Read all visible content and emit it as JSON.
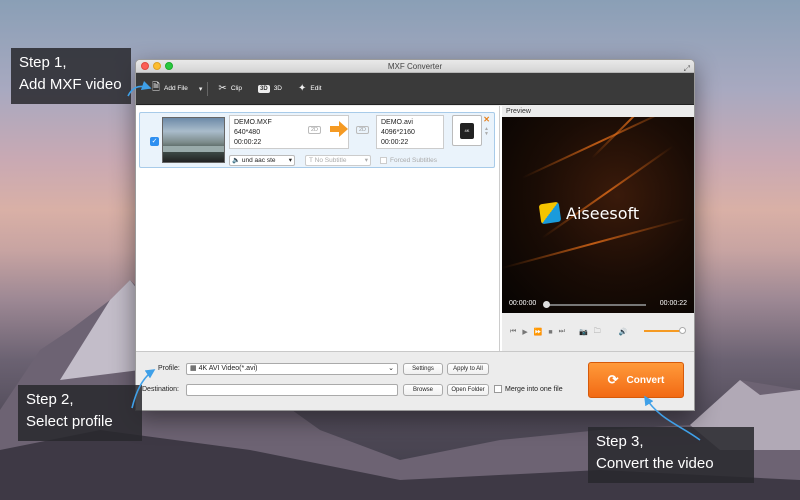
{
  "window": {
    "title": "MXF Converter"
  },
  "toolbar": {
    "add_file": "Add File",
    "clip": "Clip",
    "three_d_badge": "3D",
    "three_d": "3D",
    "edit": "Edit"
  },
  "file_item": {
    "source_name": "DEMO.MXF",
    "source_resolution": "640*480",
    "source_duration": "00:00:22",
    "dest_name": "DEMO.avi",
    "dest_resolution": "4096*2160",
    "dest_duration": "00:00:22",
    "tag_2d": "2D",
    "audio_track": "und aac ste",
    "subtitle": "No Subtitle",
    "forced_subtitles": "Forced Subtitles"
  },
  "preview": {
    "label": "Preview",
    "logo_text": "Aiseesoft",
    "time_current": "00:00:00",
    "time_total": "00:00:22"
  },
  "bottom": {
    "profile_label": "Profile:",
    "profile_value": "4K AVI Video(*.avi)",
    "settings": "Settings",
    "apply_to_all": "Apply to All",
    "destination_label": "Destination:",
    "browse": "Browse",
    "open_folder": "Open Folder",
    "merge": "Merge into one file",
    "convert": "Convert"
  },
  "callouts": {
    "step1_line1": "Step 1,",
    "step1_line2": "Add MXF video",
    "step2_line1": "Step 2,",
    "step2_line2": "Select profile",
    "step3_line1": "Step 3,",
    "step3_line2": "Convert the video"
  },
  "colors": {
    "accent_orange": "#f59a23",
    "toolbar_bg": "#3a3a3a",
    "selection_blue": "#2e8ff0",
    "callout_arrow": "#3fa0e8"
  },
  "icons": [
    "add-file-icon",
    "scissors-icon",
    "edit-wand-icon",
    "arrow-right-icon",
    "film-format-icon",
    "play-icon",
    "stop-icon",
    "camera-icon",
    "folder-icon",
    "volume-icon",
    "convert-refresh-icon"
  ]
}
